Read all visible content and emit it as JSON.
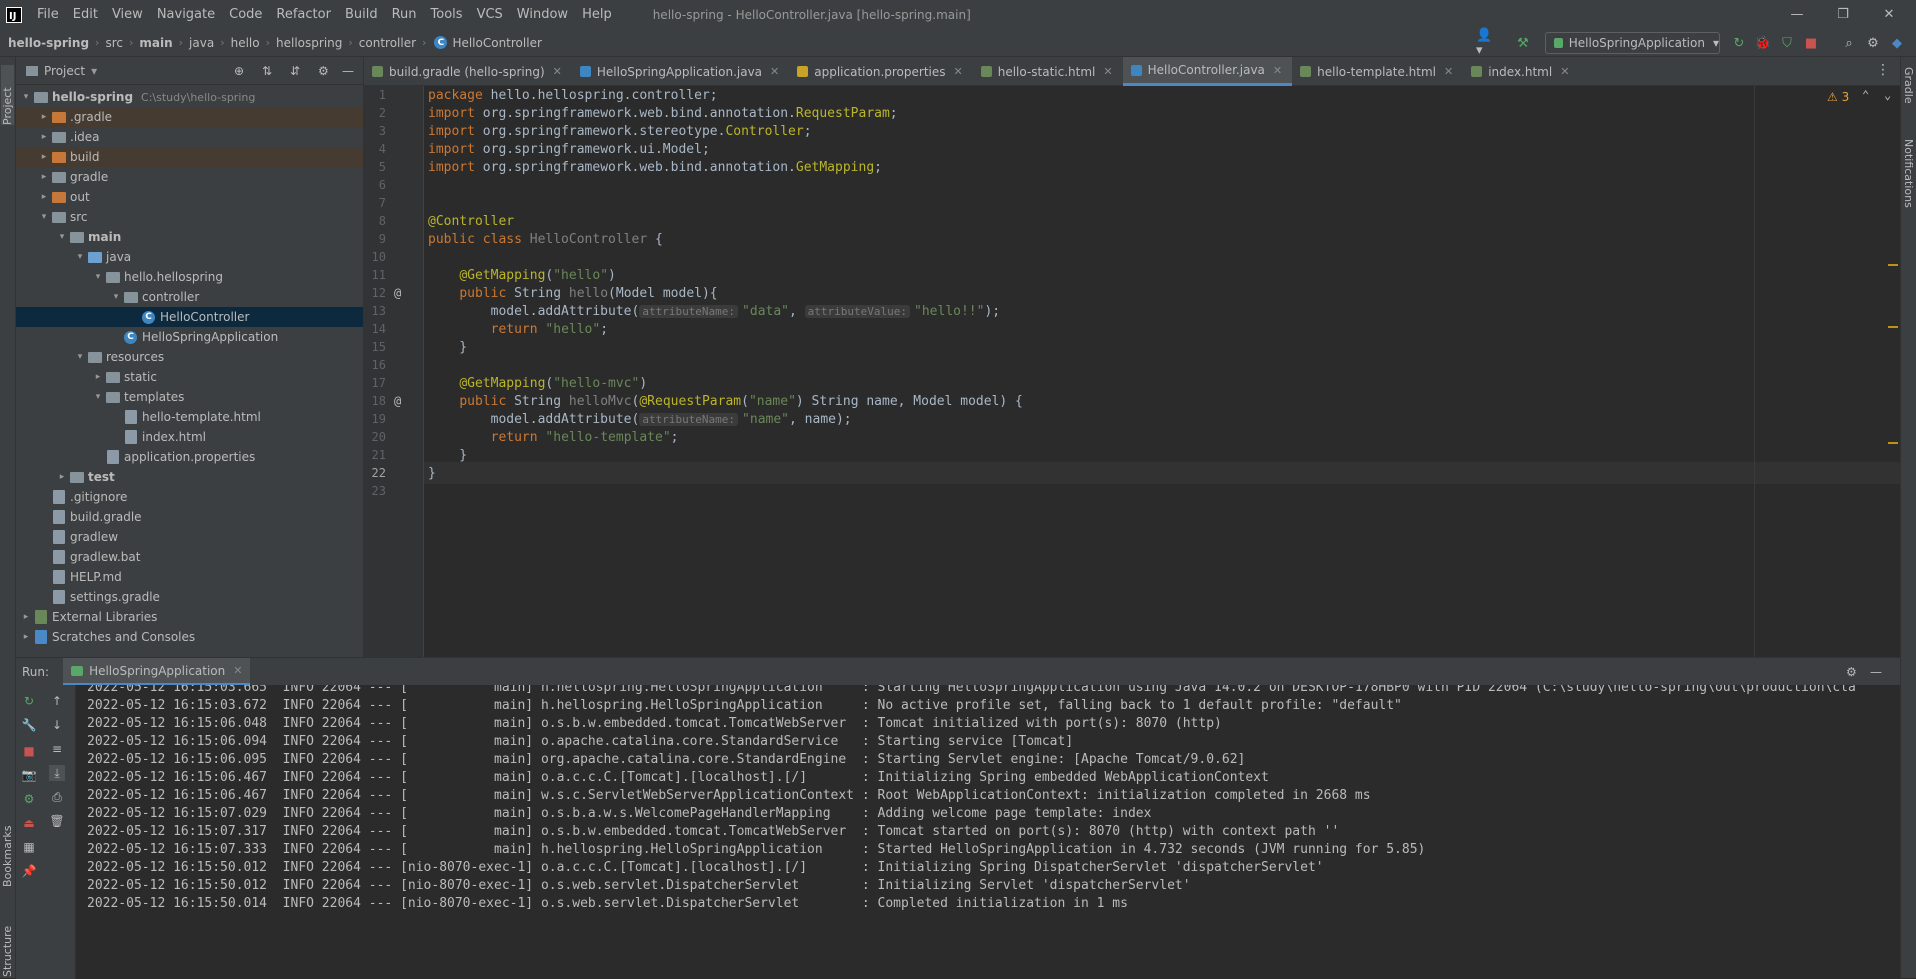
{
  "menubar": {
    "items": [
      "File",
      "Edit",
      "View",
      "Navigate",
      "Code",
      "Refactor",
      "Build",
      "Run",
      "Tools",
      "VCS",
      "Window",
      "Help"
    ],
    "title": "hello-spring - HelloController.java [hello-spring.main]"
  },
  "breadcrumb": [
    "hello-spring",
    "src",
    "main",
    "java",
    "hello",
    "hellospring",
    "controller",
    "HelloController"
  ],
  "run_config": "HelloSpringApplication",
  "left_strip": {
    "project": "Project",
    "bookmarks": "Bookmarks",
    "structure": "Structure"
  },
  "right_strip": {
    "gradle": "Gradle",
    "notifications": "Notifications"
  },
  "project_panel": {
    "title": "Project",
    "tree": [
      {
        "label": "hello-spring",
        "extra": "C:\\study\\hello-spring",
        "depth": 0,
        "arrow": "▾",
        "icon": "folder-gray",
        "bold": true
      },
      {
        "label": ".gradle",
        "depth": 1,
        "arrow": "▸",
        "icon": "folder-orange",
        "hl": true
      },
      {
        "label": ".idea",
        "depth": 1,
        "arrow": "▸",
        "icon": "folder-gray"
      },
      {
        "label": "build",
        "depth": 1,
        "arrow": "▸",
        "icon": "folder-orange",
        "hl": true
      },
      {
        "label": "gradle",
        "depth": 1,
        "arrow": "▸",
        "icon": "folder-gray"
      },
      {
        "label": "out",
        "depth": 1,
        "arrow": "▸",
        "icon": "folder-orange"
      },
      {
        "label": "src",
        "depth": 1,
        "arrow": "▾",
        "icon": "folder-gray"
      },
      {
        "label": "main",
        "depth": 2,
        "arrow": "▾",
        "icon": "folder-gray",
        "bold": true
      },
      {
        "label": "java",
        "depth": 3,
        "arrow": "▾",
        "icon": "folder-blue"
      },
      {
        "label": "hello.hellospring",
        "depth": 4,
        "arrow": "▾",
        "icon": "folder-gray"
      },
      {
        "label": "controller",
        "depth": 5,
        "arrow": "▾",
        "icon": "folder-gray"
      },
      {
        "label": "HelloController",
        "depth": 6,
        "arrow": "",
        "icon": "class",
        "selected": true
      },
      {
        "label": "HelloSpringApplication",
        "depth": 5,
        "arrow": "",
        "icon": "class"
      },
      {
        "label": "resources",
        "depth": 3,
        "arrow": "▾",
        "icon": "folder-gray"
      },
      {
        "label": "static",
        "depth": 4,
        "arrow": "▸",
        "icon": "folder-gray"
      },
      {
        "label": "templates",
        "depth": 4,
        "arrow": "▾",
        "icon": "folder-gray"
      },
      {
        "label": "hello-template.html",
        "depth": 5,
        "arrow": "",
        "icon": "file"
      },
      {
        "label": "index.html",
        "depth": 5,
        "arrow": "",
        "icon": "file"
      },
      {
        "label": "application.properties",
        "depth": 4,
        "arrow": "",
        "icon": "file"
      },
      {
        "label": "test",
        "depth": 2,
        "arrow": "▸",
        "icon": "folder-gray",
        "bold": true
      },
      {
        "label": ".gitignore",
        "depth": 1,
        "arrow": "",
        "icon": "file"
      },
      {
        "label": "build.gradle",
        "depth": 1,
        "arrow": "",
        "icon": "file"
      },
      {
        "label": "gradlew",
        "depth": 1,
        "arrow": "",
        "icon": "file"
      },
      {
        "label": "gradlew.bat",
        "depth": 1,
        "arrow": "",
        "icon": "file"
      },
      {
        "label": "HELP.md",
        "depth": 1,
        "arrow": "",
        "icon": "file"
      },
      {
        "label": "settings.gradle",
        "depth": 1,
        "arrow": "",
        "icon": "file"
      },
      {
        "label": "External Libraries",
        "depth": 0,
        "arrow": "▸",
        "icon": "lib"
      },
      {
        "label": "Scratches and Consoles",
        "depth": 0,
        "arrow": "▸",
        "icon": "scratch"
      }
    ]
  },
  "tabs": [
    {
      "label": "build.gradle (hello-spring)",
      "color": "#6a8759"
    },
    {
      "label": "HelloSpringApplication.java",
      "color": "#3e86c2"
    },
    {
      "label": "application.properties",
      "color": "#c9a227"
    },
    {
      "label": "hello-static.html",
      "color": "#6a8759"
    },
    {
      "label": "HelloController.java",
      "color": "#3e86c2",
      "active": true
    },
    {
      "label": "hello-template.html",
      "color": "#6a8759"
    },
    {
      "label": "index.html",
      "color": "#6a8759"
    }
  ],
  "editor": {
    "warnings": "3",
    "lines": [
      [
        [
          "kw",
          "package "
        ],
        [
          "",
          "hello.hellospring.controller;"
        ]
      ],
      [
        [
          "kw",
          "import "
        ],
        [
          "",
          "org.springframework.web.bind.annotation."
        ],
        [
          "an",
          "RequestParam"
        ],
        [
          "",
          ";"
        ]
      ],
      [
        [
          "kw",
          "import "
        ],
        [
          "",
          "org.springframework.stereotype."
        ],
        [
          "an",
          "Controller"
        ],
        [
          "",
          ";"
        ]
      ],
      [
        [
          "kw",
          "import "
        ],
        [
          "",
          "org.springframework.ui.Model;"
        ]
      ],
      [
        [
          "kw",
          "import "
        ],
        [
          "",
          "org.springframework.web.bind.annotation."
        ],
        [
          "an",
          "GetMapping"
        ],
        [
          "",
          ";"
        ]
      ],
      [],
      [],
      [
        [
          "an",
          "@Controller"
        ]
      ],
      [
        [
          "kw",
          "public class "
        ],
        [
          "cls",
          "HelloController "
        ],
        [
          "",
          "{"
        ]
      ],
      [],
      [
        [
          "",
          "    "
        ],
        [
          "an",
          "@GetMapping"
        ],
        [
          "",
          "("
        ],
        [
          "str",
          "\"hello\""
        ],
        [
          "",
          ")"
        ]
      ],
      [
        [
          "",
          "    "
        ],
        [
          "kw",
          "public "
        ],
        [
          "",
          "String "
        ],
        [
          "cls",
          "hello"
        ],
        [
          "",
          "(Model model){"
        ]
      ],
      [
        [
          "",
          "        model.addAttribute("
        ],
        [
          "hint",
          "attributeName:"
        ],
        [
          "str",
          "\"data\""
        ],
        [
          "",
          ", "
        ],
        [
          "hint",
          "attributeValue:"
        ],
        [
          "str",
          "\"hello!!\""
        ],
        [
          "",
          ");"
        ]
      ],
      [
        [
          "",
          "        "
        ],
        [
          "kw",
          "return "
        ],
        [
          "str",
          "\"hello\""
        ],
        [
          "",
          ";"
        ]
      ],
      [
        [
          "",
          "    }"
        ]
      ],
      [],
      [
        [
          "",
          "    "
        ],
        [
          "an",
          "@GetMapping"
        ],
        [
          "",
          "("
        ],
        [
          "str",
          "\"hello-mvc\""
        ],
        [
          "",
          ")"
        ]
      ],
      [
        [
          "",
          "    "
        ],
        [
          "kw",
          "public "
        ],
        [
          "",
          "String "
        ],
        [
          "cls",
          "helloMvc"
        ],
        [
          "",
          "("
        ],
        [
          "an",
          "@RequestParam"
        ],
        [
          "",
          "("
        ],
        [
          "str",
          "\"name\""
        ],
        [
          "",
          ") String name, Model model) {"
        ]
      ],
      [
        [
          "",
          "        model.addAttribute("
        ],
        [
          "hint",
          "attributeName:"
        ],
        [
          "str",
          "\"name\""
        ],
        [
          "",
          ", name);"
        ]
      ],
      [
        [
          "",
          "        "
        ],
        [
          "kw",
          "return "
        ],
        [
          "str",
          "\"hello-template\""
        ],
        [
          "",
          ";"
        ]
      ],
      [
        [
          "",
          "    }"
        ]
      ],
      [
        [
          "",
          "}"
        ]
      ],
      []
    ]
  },
  "run": {
    "label": "Run:",
    "tab": "HelloSpringApplication",
    "log": [
      "2022-05-12 16:15:03.665  INFO 22064 --- [           main] h.hellospring.HelloSpringApplication     : Starting HelloSpringApplication using Java 14.0.2 on DESKTOP-178HBP0 with PID 22064 (C:\\study\\hello-spring\\out\\production\\cla",
      "2022-05-12 16:15:03.672  INFO 22064 --- [           main] h.hellospring.HelloSpringApplication     : No active profile set, falling back to 1 default profile: \"default\"",
      "2022-05-12 16:15:06.048  INFO 22064 --- [           main] o.s.b.w.embedded.tomcat.TomcatWebServer  : Tomcat initialized with port(s): 8070 (http)",
      "2022-05-12 16:15:06.094  INFO 22064 --- [           main] o.apache.catalina.core.StandardService   : Starting service [Tomcat]",
      "2022-05-12 16:15:06.095  INFO 22064 --- [           main] org.apache.catalina.core.StandardEngine  : Starting Servlet engine: [Apache Tomcat/9.0.62]",
      "2022-05-12 16:15:06.467  INFO 22064 --- [           main] o.a.c.c.C.[Tomcat].[localhost].[/]       : Initializing Spring embedded WebApplicationContext",
      "2022-05-12 16:15:06.467  INFO 22064 --- [           main] w.s.c.ServletWebServerApplicationContext : Root WebApplicationContext: initialization completed in 2668 ms",
      "2022-05-12 16:15:07.029  INFO 22064 --- [           main] o.s.b.a.w.s.WelcomePageHandlerMapping    : Adding welcome page template: index",
      "2022-05-12 16:15:07.317  INFO 22064 --- [           main] o.s.b.w.embedded.tomcat.TomcatWebServer  : Tomcat started on port(s): 8070 (http) with context path ''",
      "2022-05-12 16:15:07.333  INFO 22064 --- [           main] h.hellospring.HelloSpringApplication     : Started HelloSpringApplication in 4.732 seconds (JVM running for 5.85)",
      "2022-05-12 16:15:50.012  INFO 22064 --- [nio-8070-exec-1] o.a.c.c.C.[Tomcat].[localhost].[/]       : Initializing Spring DispatcherServlet 'dispatcherServlet'",
      "2022-05-12 16:15:50.012  INFO 22064 --- [nio-8070-exec-1] o.s.web.servlet.DispatcherServlet        : Initializing Servlet 'dispatcherServlet'",
      "2022-05-12 16:15:50.014  INFO 22064 --- [nio-8070-exec-1] o.s.web.servlet.DispatcherServlet        : Completed initialization in 1 ms"
    ]
  }
}
